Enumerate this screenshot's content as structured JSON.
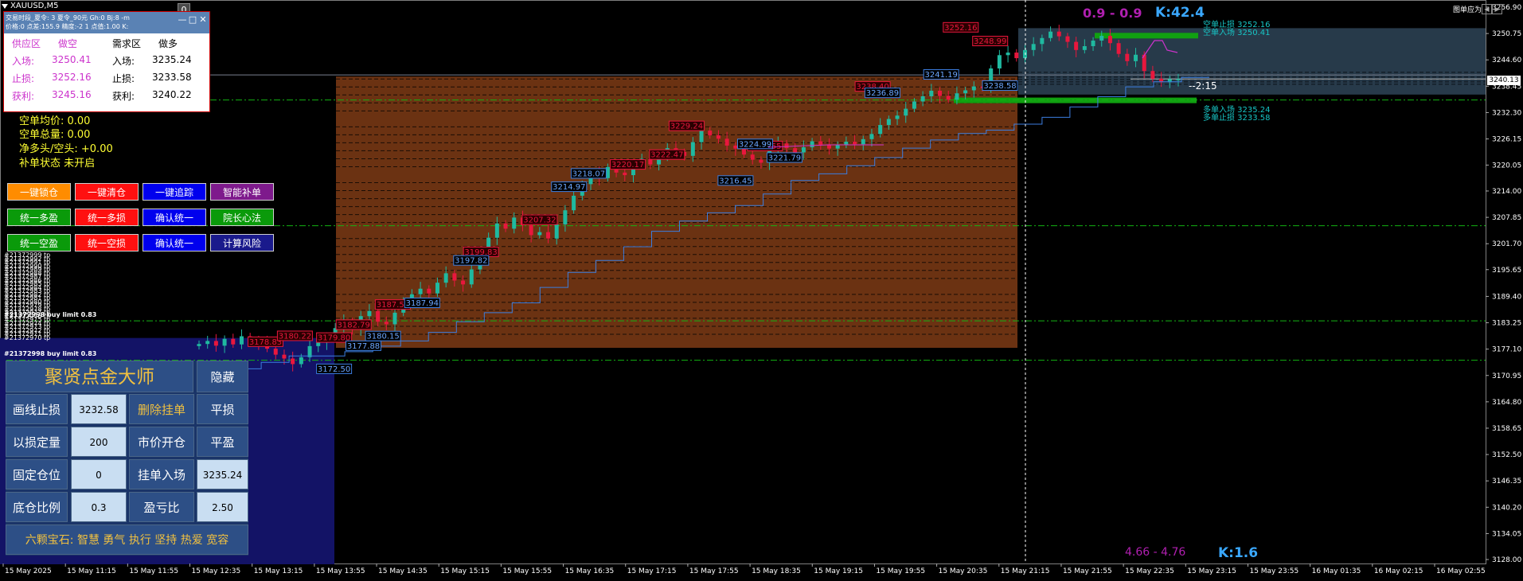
{
  "window": {
    "symbol_tab": "XAUUSD,M5",
    "corner_info": "图单应为",
    "zero_badge": "0"
  },
  "info_window": {
    "header_line1": "交易时段_夏令: 3  夏令_90元  Gh:0 Bj:8 -m",
    "header_line2": "价格:0  点差:155.9  精度:-2  1  点值:1.00  K:",
    "supply_label": "供应区",
    "supply_dir": "做空",
    "demand_label": "需求区",
    "demand_dir": "做多",
    "entry_label": "入场:",
    "sl_label": "止损:",
    "tp_label": "获利:",
    "supply_entry": "3250.41",
    "supply_sl": "3252.16",
    "supply_tp": "3245.16",
    "demand_entry": "3235.24",
    "demand_sl": "3233.58",
    "demand_tp": "3240.22"
  },
  "status": {
    "short_avg": "空单均价: 0.00",
    "short_total": "空单总量: 0.00",
    "net": "净多头/空头: +0.00",
    "refill": "补单状态 未开启"
  },
  "buttons": [
    {
      "label": "一键锁仓",
      "color": "#ff8c00"
    },
    {
      "label": "一键清仓",
      "color": "#ff1010"
    },
    {
      "label": "一键追踪",
      "color": "#0000ee"
    },
    {
      "label": "智能补单",
      "color": "#7e1a8c"
    },
    {
      "label": "统一多盈",
      "color": "#0a9a0a"
    },
    {
      "label": "统一多损",
      "color": "#ff1010"
    },
    {
      "label": "确认统一",
      "color": "#0000ee"
    },
    {
      "label": "院长心法",
      "color": "#0a9a0a"
    },
    {
      "label": "统一空盈",
      "color": "#0a9a0a"
    },
    {
      "label": "统一空损",
      "color": "#ff1010"
    },
    {
      "label": "确认统一",
      "color": "#0000ee"
    },
    {
      "label": "计算风险",
      "color": "#1a1a8c"
    }
  ],
  "order_labels": [
    "#21372999 tp",
    "#21372992 tp",
    "#21372991 tp",
    "#21372990 tp",
    "#21372989 tp",
    "#21372988 tp",
    "#21372987 tp",
    "#21372986 tp",
    "#21372985 tp",
    "#21372984 tp",
    "#21372983 tp",
    "#21372982 tp",
    "#21372981 tp",
    "#21372980 tp",
    "#21372979 tp",
    "#21372978 tp",
    "#21372977 tp",
    "#21372976 tp",
    "#21372975 tp",
    "#21372974 tp",
    "#21372973 tp",
    "#21372972 tp",
    "#21372971 tp",
    "#21372970 tp"
  ],
  "order_buy_limit1": "#21372998 buy limit 0.83",
  "order_buy_limit2": "#21372998 buy limit 0.83",
  "panel": {
    "title": "聚贤点金大师",
    "hide": "隐藏",
    "draw_sl_label": "画线止损",
    "draw_sl_value": "3232.58",
    "delete_order": "删除挂单",
    "close_sl": "平损",
    "risk_label": "以损定量",
    "risk_value": "200",
    "market_open": "市价开仓",
    "close_tp": "平盈",
    "fixed_label": "固定仓位",
    "fixed_value": "0",
    "pending_entry": "挂单入场",
    "pending_value": "3235.24",
    "base_ratio_label": "底仓比例",
    "base_ratio_value": "0.3",
    "rr_label": "盈亏比",
    "rr_value": "2.50",
    "gems": "六颗宝石: 智慧 勇气 执行 坚持 热爱 宽容"
  },
  "overlay": {
    "k_top_ratio": "0.9 - 0.9",
    "k_top": "K:42.4",
    "k_bot_ratio": "4.66 - 4.76",
    "k_bot": "K:1.6",
    "timer": "2:15",
    "supply_sl_tag": "空单止损 3252.16",
    "supply_entry_tag": "空单入场 3250.41",
    "demand_entry_tag": "多单入场 3235.24",
    "demand_sl_tag": "多单止损 3233.58",
    "current_price": "3240.13"
  },
  "colors": {
    "up": "#1fb9a0",
    "down": "#e8173d",
    "support": "#3b7ee0",
    "zone": "#6b3212",
    "grid_dash": "#13b313"
  },
  "chart_data": {
    "type": "candlestick",
    "symbol": "XAUUSD,M5",
    "ylim": [
      3128.0,
      3256.9
    ],
    "y_ticks": [
      "3256.90",
      "3250.75",
      "3244.60",
      "3238.45",
      "3232.30",
      "3226.15",
      "3220.05",
      "3214.00",
      "3207.85",
      "3201.70",
      "3195.65",
      "3189.40",
      "3183.25",
      "3177.10",
      "3170.95",
      "3164.80",
      "3158.65",
      "3152.50",
      "3146.35",
      "3140.20",
      "3134.05",
      "3128.00"
    ],
    "x_ticks": [
      "15 May 2025",
      "15 May 11:15",
      "15 May 11:55",
      "15 May 12:35",
      "15 May 13:15",
      "15 May 13:55",
      "15 May 14:35",
      "15 May 15:15",
      "15 May 15:55",
      "15 May 16:35",
      "15 May 17:15",
      "15 May 17:55",
      "15 May 18:35",
      "15 May 19:15",
      "15 May 19:55",
      "15 May 20:35",
      "15 May 21:15",
      "15 May 21:55",
      "15 May 22:35",
      "15 May 23:15",
      "15 May 23:55",
      "16 May 01:35",
      "16 May 02:15",
      "16 May 02:55"
    ],
    "candles_close": [
      3178.3,
      3179.0,
      3177.9,
      3179.5,
      3178.2,
      3180.1,
      3179.0,
      3178.6,
      3177.2,
      3175.8,
      3174.9,
      3173.6,
      3175.2,
      3177.8,
      3178.6,
      3180.2,
      3182.0,
      3183.6,
      3181.9,
      3184.8,
      3186.0,
      3183.5,
      3182.9,
      3185.6,
      3188.4,
      3189.9,
      3191.2,
      3190.1,
      3192.6,
      3194.8,
      3193.1,
      3192.2,
      3195.7,
      3199.3,
      3203.1,
      3206.4,
      3205.2,
      3207.8,
      3206.0,
      3203.7,
      3204.4,
      3202.9,
      3206.2,
      3209.5,
      3212.9,
      3215.6,
      3218.1,
      3217.0,
      3219.6,
      3218.3,
      3217.7,
      3219.9,
      3221.5,
      3220.2,
      3222.7,
      3224.0,
      3223.1,
      3222.2,
      3225.4,
      3228.1,
      3227.0,
      3226.2,
      3224.6,
      3223.9,
      3222.5,
      3221.3,
      3220.6,
      3223.7,
      3225.1,
      3224.0,
      3223.0,
      3224.2,
      3225.6,
      3224.7,
      3223.9,
      3224.8,
      3225.5,
      3224.9,
      3226.1,
      3227.3,
      3229.4,
      3230.8,
      3231.6,
      3233.2,
      3234.9,
      3236.1,
      3237.4,
      3236.2,
      3235.3,
      3236.8,
      3237.5,
      3238.4,
      3238.0,
      3242.6,
      3245.7,
      3246.3,
      3245.0,
      3246.9,
      3248.3,
      3249.7,
      3251.2,
      3250.1,
      3248.8,
      3246.9,
      3247.8,
      3249.1,
      3250.2,
      3248.5,
      3246.0,
      3244.3,
      3245.8,
      3242.0,
      3240.2,
      3239.4,
      3240.1,
      3240.13
    ],
    "candles_open": [
      3177.8,
      3178.3,
      3179.0,
      3177.9,
      3179.5,
      3178.2,
      3180.1,
      3179.0,
      3178.6,
      3177.2,
      3175.8,
      3174.9,
      3173.6,
      3175.2,
      3177.8,
      3178.6,
      3180.2,
      3182.0,
      3183.6,
      3181.9,
      3184.8,
      3186.0,
      3183.5,
      3182.9,
      3185.6,
      3188.4,
      3189.9,
      3191.2,
      3190.1,
      3192.6,
      3194.8,
      3193.1,
      3192.2,
      3195.7,
      3199.3,
      3203.1,
      3206.4,
      3205.2,
      3207.8,
      3206.0,
      3203.7,
      3204.4,
      3202.9,
      3206.2,
      3209.5,
      3212.9,
      3215.6,
      3218.1,
      3217.0,
      3219.6,
      3218.3,
      3217.7,
      3219.9,
      3221.5,
      3220.2,
      3222.7,
      3224.0,
      3223.1,
      3222.2,
      3225.4,
      3228.1,
      3227.0,
      3226.2,
      3224.6,
      3223.9,
      3222.5,
      3221.3,
      3220.6,
      3223.7,
      3225.1,
      3224.0,
      3223.0,
      3224.2,
      3225.6,
      3224.7,
      3223.9,
      3224.8,
      3225.5,
      3224.9,
      3226.1,
      3227.3,
      3229.4,
      3230.8,
      3231.6,
      3233.2,
      3234.9,
      3236.1,
      3237.4,
      3236.2,
      3235.3,
      3236.8,
      3237.5,
      3238.4,
      3238.0,
      3242.6,
      3245.7,
      3246.3,
      3245.0,
      3246.9,
      3248.3,
      3249.7,
      3251.2,
      3250.1,
      3248.8,
      3246.9,
      3247.8,
      3249.1,
      3250.2,
      3248.5,
      3246.0,
      3244.3,
      3245.8,
      3242.0,
      3240.2,
      3239.4,
      3240.1
    ],
    "support_line": [
      3172.5,
      3172.5,
      3174.0,
      3175.5,
      3175.5,
      3176.5,
      3177.8,
      3179.0,
      3181.0,
      3183.5,
      3185.6,
      3187.9,
      3191.5,
      3195.0,
      3197.8,
      3201.0,
      3204.6,
      3207.0,
      3208.9,
      3210.6,
      3213.3,
      3216.45,
      3218.0,
      3219.9,
      3221.8,
      3224.0,
      3225.9,
      3227.4,
      3228.2,
      3229.6,
      3231.2,
      3233.6,
      3236.0,
      3238.3,
      3239.5,
      3240.5
    ],
    "labels_red": [
      {
        "text": "3178.83",
        "price": 3178.83,
        "pos": 0.05
      },
      {
        "text": "3180.22",
        "price": 3180.2,
        "pos": 0.08
      },
      {
        "text": "3179.80",
        "price": 3179.8,
        "pos": 0.12
      },
      {
        "text": "3182.79",
        "price": 3182.8,
        "pos": 0.14
      },
      {
        "text": "3187.52",
        "price": 3187.5,
        "pos": 0.18
      },
      {
        "text": "3199.83",
        "price": 3199.8,
        "pos": 0.27
      },
      {
        "text": "3207.32",
        "price": 3207.3,
        "pos": 0.33
      },
      {
        "text": "3220.17",
        "price": 3220.2,
        "pos": 0.42
      },
      {
        "text": "3222.47",
        "price": 3222.5,
        "pos": 0.46
      },
      {
        "text": "3229.24",
        "price": 3229.2,
        "pos": 0.48
      },
      {
        "text": "3224.55",
        "price": 3224.5,
        "pos": 0.56
      },
      {
        "text": "3238.40",
        "price": 3238.4,
        "pos": 0.67
      },
      {
        "text": "3252.16",
        "price": 3252.2,
        "pos": 0.76
      },
      {
        "text": "3248.99",
        "price": 3249.0,
        "pos": 0.79
      }
    ],
    "labels_blue": [
      {
        "text": "3172.50",
        "price": 3172.5,
        "pos": 0.12
      },
      {
        "text": "3177.88",
        "price": 3177.9,
        "pos": 0.15
      },
      {
        "text": "3180.15",
        "price": 3180.15,
        "pos": 0.17
      },
      {
        "text": "3187.94",
        "price": 3187.9,
        "pos": 0.21
      },
      {
        "text": "3197.82",
        "price": 3197.8,
        "pos": 0.26
      },
      {
        "text": "3214.97",
        "price": 3215.0,
        "pos": 0.36
      },
      {
        "text": "3218.07",
        "price": 3218.1,
        "pos": 0.38
      },
      {
        "text": "3216.45",
        "price": 3216.45,
        "pos": 0.53
      },
      {
        "text": "3224.99",
        "price": 3225.0,
        "pos": 0.55
      },
      {
        "text": "3221.79",
        "price": 3221.8,
        "pos": 0.58
      },
      {
        "text": "3236.89",
        "price": 3236.9,
        "pos": 0.68
      },
      {
        "text": "3241.19",
        "price": 3241.2,
        "pos": 0.74
      },
      {
        "text": "3238.58",
        "price": 3238.6,
        "pos": 0.8
      }
    ],
    "zone_top": 3240.7,
    "zone_bottom": 3177.4,
    "box_top": 3252.0,
    "box_bottom": 3236.5,
    "hlines": [
      3235.24,
      3205.9,
      3183.7,
      3174.5
    ],
    "current_price": 3240.13
  }
}
